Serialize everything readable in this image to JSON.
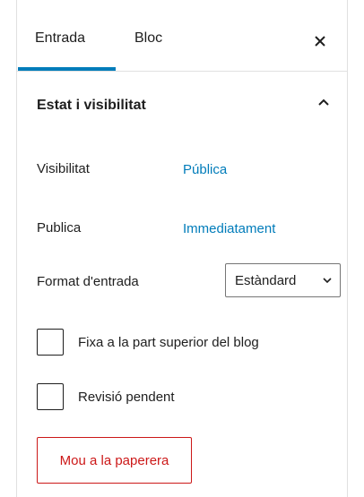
{
  "tabs": [
    {
      "label": "Entrada",
      "active": true
    },
    {
      "label": "Bloc",
      "active": false
    }
  ],
  "close_icon": "close-icon",
  "section": {
    "title": "Estat i visibilitat",
    "toggle_icon": "chevron-up-icon",
    "expanded": true
  },
  "visibility": {
    "label": "Visibilitat",
    "value": "Pública"
  },
  "publish": {
    "label": "Publica",
    "value": "Immediatament"
  },
  "post_format": {
    "label": "Format d'entrada",
    "selected": "Estàndard"
  },
  "checkboxes": [
    {
      "label": "Fixa a la part superior del blog",
      "checked": false
    },
    {
      "label": "Revisió pendent",
      "checked": false
    }
  ],
  "trash_button": {
    "label": "Mou a la paperera"
  },
  "colors": {
    "accent": "#007cba",
    "danger": "#cc1818",
    "border": "#e0e0e0",
    "text": "#1e1e1e"
  }
}
